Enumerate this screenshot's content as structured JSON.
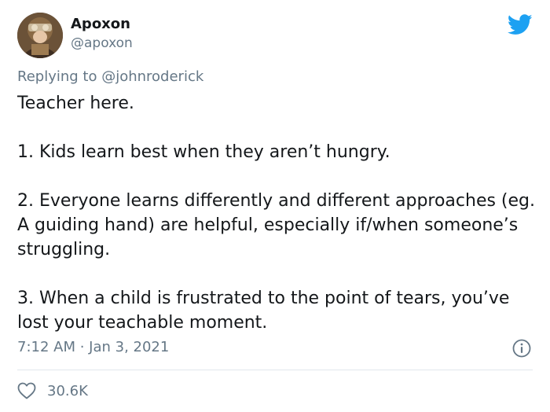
{
  "author": {
    "display_name": "Apoxon",
    "handle": "@apoxon",
    "avatar_icon": "avatar-image"
  },
  "reply": {
    "prefix": "Replying to ",
    "mention": "@johnroderick"
  },
  "tweet": {
    "paragraphs": [
      "Teacher here.",
      "1. Kids learn best when they aren’t hungry.",
      "2. Everyone learns differently and different approaches (eg. A guiding hand) are helpful, especially if/when someone’s struggling.",
      "3. When a child is frustrated to the point of tears, you’ve lost your teachable moment."
    ],
    "timestamp": "7:12 AM · Jan 3, 2021"
  },
  "actions": {
    "like_count": "30.6K"
  },
  "colors": {
    "brand_blue": "#1da1f2",
    "muted": "#657786",
    "text": "#14171a",
    "divider": "#e1e8ed"
  },
  "icons": [
    "twitter-bird-icon",
    "info-icon",
    "heart-icon"
  ]
}
